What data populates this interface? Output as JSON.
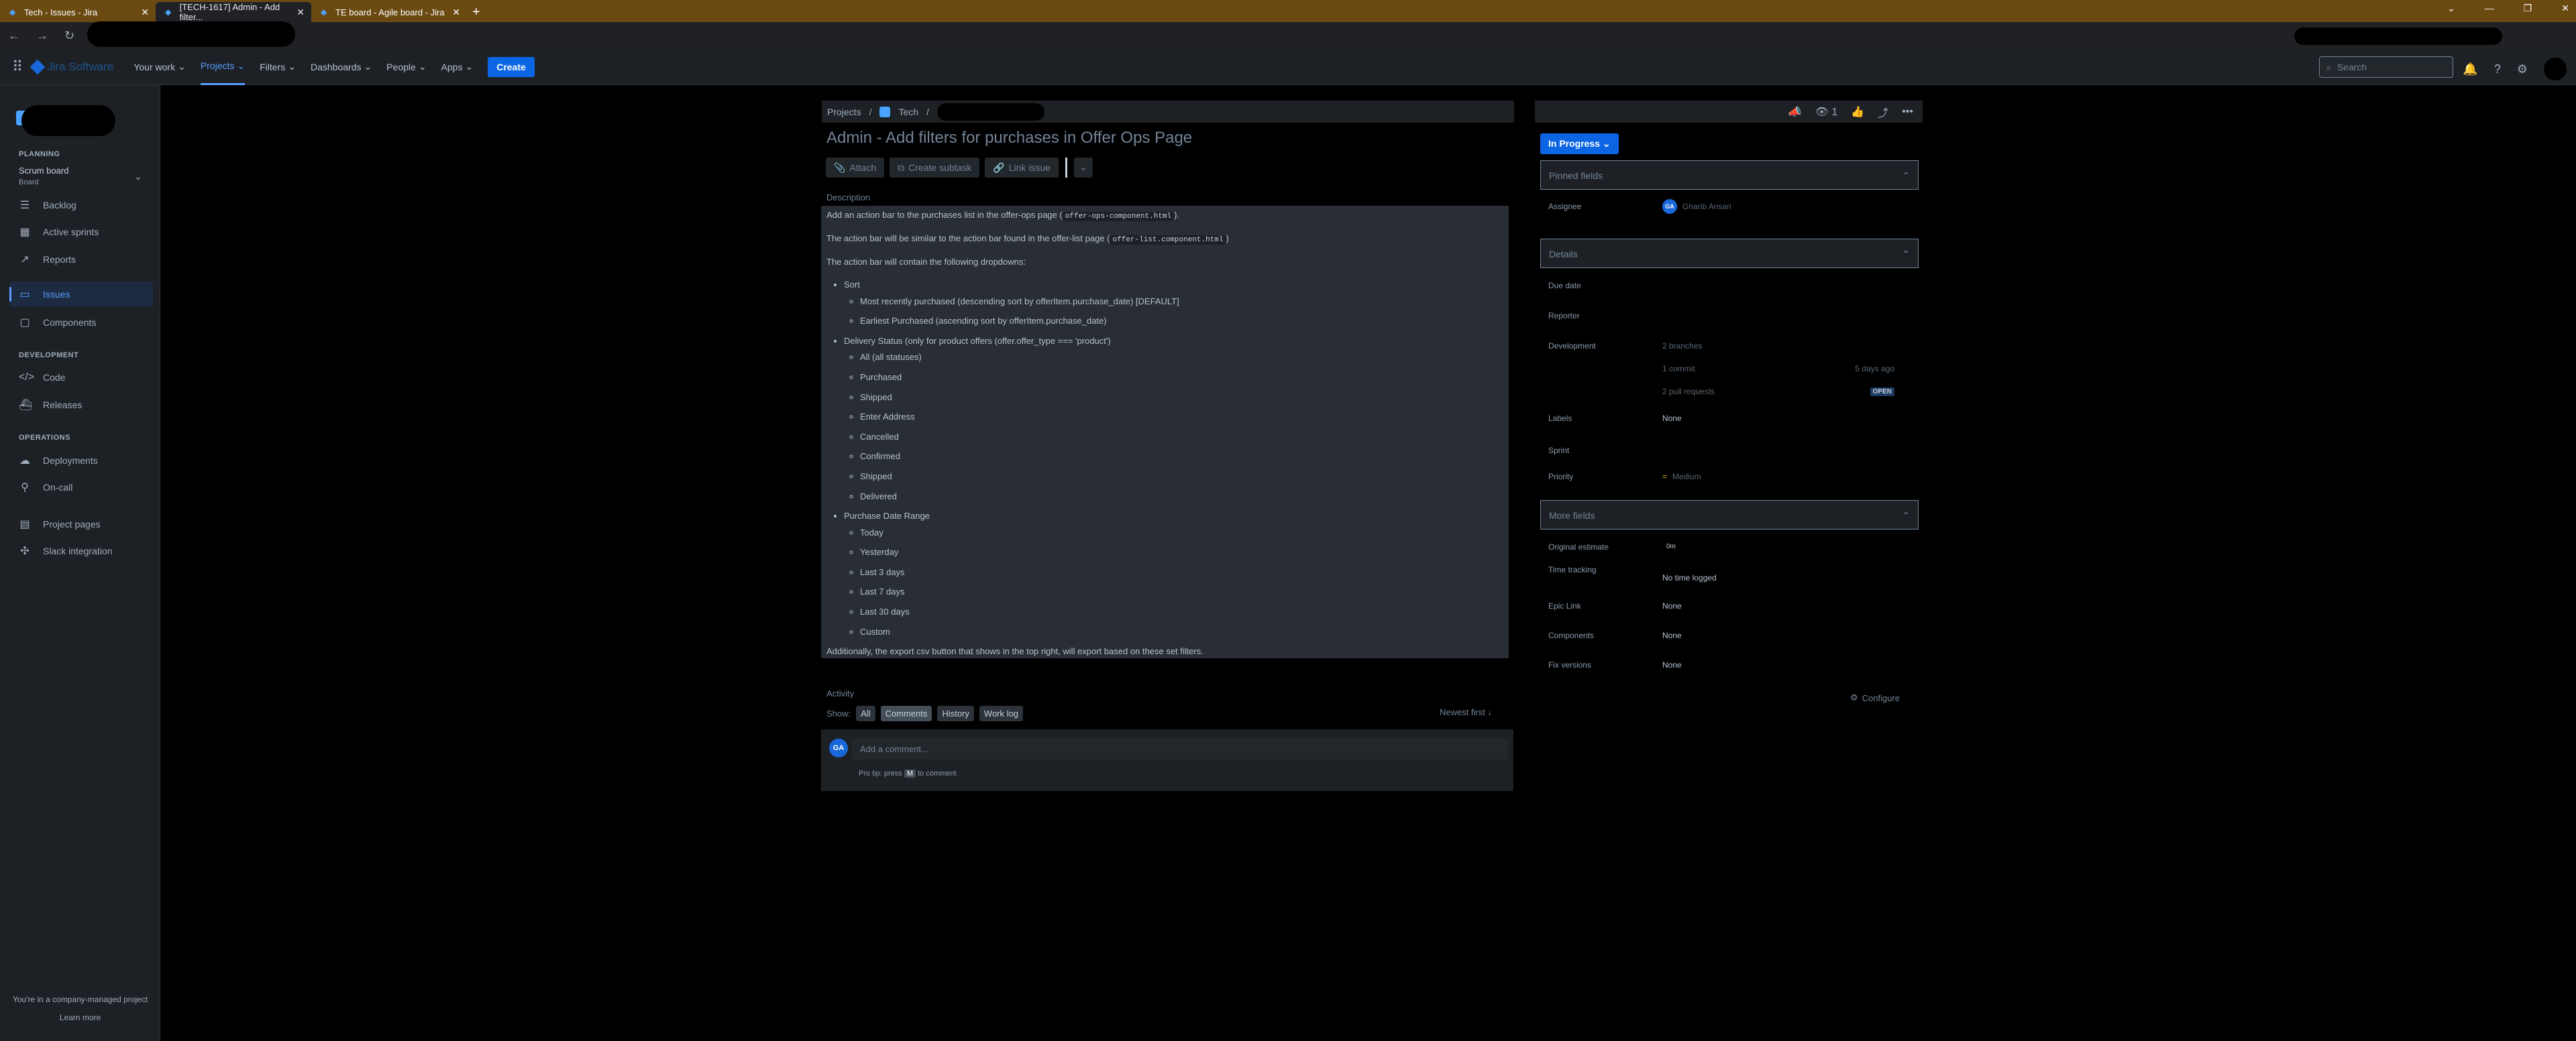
{
  "browser": {
    "tabs": [
      {
        "title": "Tech - Issues - Jira",
        "active": false
      },
      {
        "title": "[TECH-1617] Admin - Add filter...",
        "active": true
      },
      {
        "title": "TE board - Agile board - Jira",
        "active": false
      }
    ],
    "new_tab": "+",
    "window_controls": [
      "⌄",
      "—",
      "❐",
      "✕"
    ]
  },
  "topnav": {
    "product": "Jira Software",
    "items": [
      "Your work",
      "Projects",
      "Filters",
      "Dashboards",
      "People",
      "Apps"
    ],
    "create": "Create",
    "search_placeholder": "Search"
  },
  "sidebar": {
    "planning_title": "PLANNING",
    "board_name": "Scrum board",
    "board_sub": "Board",
    "planning_items": [
      "Backlog",
      "Active sprints",
      "Reports"
    ],
    "issues": "Issues",
    "components": "Components",
    "development_title": "DEVELOPMENT",
    "development_items": [
      "Code",
      "Releases"
    ],
    "operations_title": "OPERATIONS",
    "operations_items": [
      "Deployments",
      "On-call"
    ],
    "project_pages": "Project pages",
    "slack": "Slack integration",
    "footer": "You're in a company-managed project",
    "learn_more": "Learn more"
  },
  "breadcrumb": {
    "projects": "Projects",
    "sep": "/",
    "project": "Tech"
  },
  "issue": {
    "title": "Admin - Add filters for purchases in Offer Ops Page",
    "actions": [
      "Attach",
      "Create subtask",
      "Link issue"
    ],
    "description_label": "Description",
    "desc": {
      "p1_pre": "Add an action bar to the purchases list in the offer-ops page (",
      "p1_code": "offer-ops-component.html",
      "p1_post": ").",
      "p2_pre": "The action bar will be similar to the action bar found in the offer-list page (",
      "p2_code": "offer-list.component.html",
      "p2_post": ")",
      "p3": "The action bar will contain the following dropdowns:",
      "sort": "Sort",
      "sort_items": [
        "Most recently purchased (descending sort by offerItem.purchase_date) [DEFAULT]",
        "Earliest Purchased (ascending sort by offerItem.purchase_date)"
      ],
      "delivery": "Delivery Status (only for product offers (offer.offer_type === 'product')",
      "delivery_items": [
        "All (all statuses)",
        "Purchased",
        "Shipped",
        "Enter Address",
        "Cancelled",
        "Confirmed",
        "Shipped",
        "Delivered"
      ],
      "range": "Purchase Date Range",
      "range_items": [
        "Today",
        "Yesterday",
        "Last 3 days",
        "Last 7 days",
        "Last 30 days",
        "Custom"
      ],
      "footer": "Additionally, the export csv button that shows in the top right, will export based on these set filters."
    },
    "activity_label": "Activity",
    "show_label": "Show:",
    "filters": [
      "All",
      "Comments",
      "History",
      "Work log"
    ],
    "newest": "Newest first ↓",
    "comment_placeholder": "Add a comment...",
    "protip_pre": "Pro tip: press",
    "protip_key": "M",
    "protip_post": "to comment",
    "user_initials": "GA"
  },
  "right_panel": {
    "watchers": "1",
    "status": "In Progress",
    "pinned_title": "Pinned fields",
    "assignee_label": "Assignee",
    "assignee": "Gharib Ansari",
    "details_title": "Details",
    "due_date_label": "Due date",
    "reporter_label": "Reporter",
    "development_label": "Development",
    "branches": "2 branches",
    "commit": "1 commit",
    "commit_time": "5 days ago",
    "pull_requests": "2 pull requests",
    "open": "OPEN",
    "labels_label": "Labels",
    "labels": "None",
    "sprint_label": "Sprint",
    "priority_label": "Priority",
    "priority": "Medium",
    "more_title": "More fields",
    "orig_label": "Original estimate",
    "orig_val": "0m",
    "time_label": "Time tracking",
    "time_val": "No time logged",
    "epic_label": "Epic Link",
    "epic_val": "None",
    "components_label": "Components",
    "components_val": "None",
    "fix_label": "Fix versions",
    "fix_val": "None",
    "configure": "Configure"
  }
}
